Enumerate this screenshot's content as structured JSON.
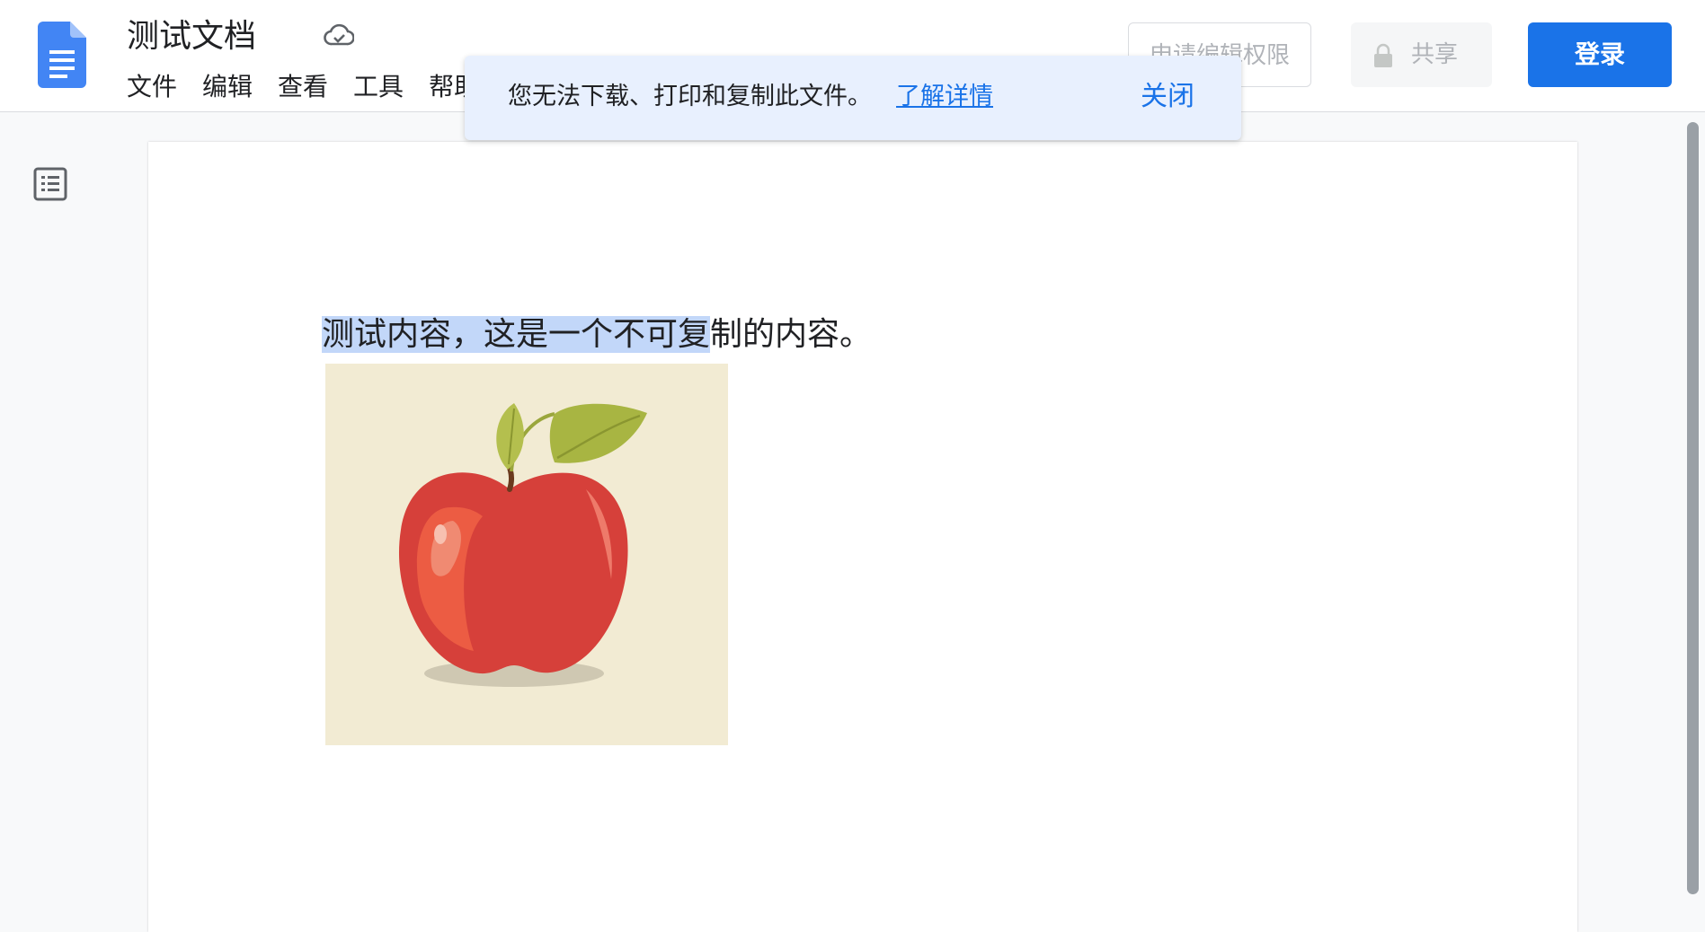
{
  "doc": {
    "title": "测试文档",
    "menu": [
      "文件",
      "编辑",
      "查看",
      "工具",
      "帮助"
    ]
  },
  "actions": {
    "request_edit": "申请编辑权限",
    "share": "共享",
    "login": "登录"
  },
  "banner": {
    "message": "您无法下载、打印和复制此文件。",
    "link": "了解详情",
    "close": "关闭"
  },
  "content": {
    "text_selected": "测试内容，这是一个不可复",
    "text_rest": "制的内容。"
  },
  "icons": {
    "logo": "docs-logo-icon",
    "cloud": "cloud-check-icon",
    "outline": "document-outline-icon",
    "lock": "lock-icon"
  },
  "colors": {
    "accent": "#1a73e8",
    "selection": "#c2d7f9",
    "banner_bg": "#e8f0fe",
    "image_bg": "#f2ebd3"
  }
}
